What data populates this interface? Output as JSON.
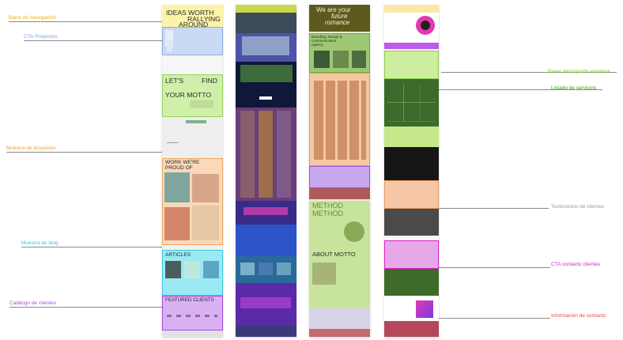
{
  "annotations": {
    "left": [
      {
        "label": "Barra de navegación",
        "color": "#f0b400"
      },
      {
        "label": "CTA Proyectos",
        "color": "#7aa7e6"
      },
      {
        "label": "Muestra de proyectos",
        "color": "#f0a030"
      },
      {
        "label": "Muestra de blog",
        "color": "#38c8e0"
      },
      {
        "label": "Catálogo de clientes",
        "color": "#a64de0"
      }
    ],
    "right": [
      {
        "label": "Breve descripción empresa",
        "color": "#7ec820"
      },
      {
        "label": "Listado de servicios",
        "color": "#3a9a14"
      },
      {
        "label": "Testimonios de clientes",
        "color": "#9a9a9a"
      },
      {
        "label": "CTA contacto clientes",
        "color": "#e020c8"
      },
      {
        "label": "Información de contacto",
        "color": "#e84a4a"
      }
    ]
  },
  "site1": {
    "headline_1": "IDEAS WORTH",
    "headline_2": "RALLYING",
    "headline_3": "AROUND",
    "motto_1": "LET'S",
    "motto_2": "FIND",
    "motto_3": "YOUR MOTTO",
    "work_1": "WORK WE'RE",
    "work_2": "PROUD OF",
    "articles": "ARTICLES",
    "clients": "FEATURED CLIENTS"
  },
  "site3": {
    "hero_1": "We are your",
    "hero_2": "future",
    "hero_3": "romance",
    "agency_1": "Branding, Design &",
    "agency_2": "Communication",
    "agency_3": "Agency",
    "method_1": "METHOD",
    "method_2": "METHOD",
    "about": "ABOUT MOTTO"
  }
}
